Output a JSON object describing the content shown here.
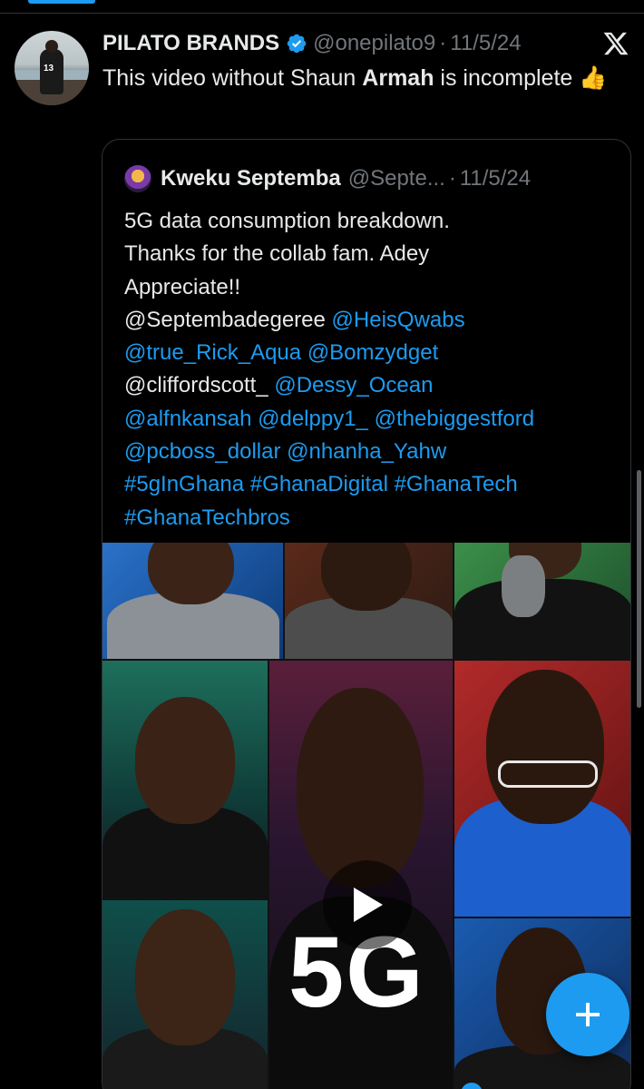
{
  "tweet": {
    "author_name": "PILATO BRANDS",
    "handle": "@onepilato9",
    "separator": "·",
    "date": "11/5/24",
    "text_before": "This video without Shaun ",
    "text_bold": "Armah",
    "text_after": " is incomplete 👍"
  },
  "quote": {
    "author_name": "Kweku Septemba",
    "handle": "@Septe...",
    "separator": "·",
    "date": "11/5/24",
    "line1": "5G data consumption breakdown.",
    "line2": "Thanks for the collab fam. Adey",
    "line3": "Appreciate!!",
    "mentions": [
      {
        "text": "@Septembadegeree",
        "link": false
      },
      {
        "text": "@HeisQwabs",
        "link": true
      },
      {
        "text": "@true_Rick_Aqua",
        "link": true
      },
      {
        "text": "@Bomzydget",
        "link": true
      },
      {
        "text": "@cliffordscott_",
        "link": false
      },
      {
        "text": "@Dessy_Ocean",
        "link": true
      },
      {
        "text": "@alfnkansah",
        "link": true
      },
      {
        "text": "@delppy1_",
        "link": true
      },
      {
        "text": "@thebiggestford",
        "link": true
      },
      {
        "text": "@pcboss_dollar",
        "link": true
      },
      {
        "text": "@nhanha_Yahw",
        "link": true
      },
      {
        "text": "#5gInGhana",
        "link": true
      },
      {
        "text": "#GhanaDigital",
        "link": true
      },
      {
        "text": "#GhanaTech",
        "link": true
      },
      {
        "text": "#GhanaTechbros",
        "link": true
      }
    ],
    "video_overlay_text": "5G"
  },
  "icons": {
    "verified": "verified-badge-icon",
    "x_logo": "x-logo-icon",
    "play": "play-icon",
    "compose": "plus-icon"
  },
  "colors": {
    "accent": "#1d9bf0",
    "background": "#000000",
    "text": "#e7e9ea",
    "muted": "#71767b"
  }
}
